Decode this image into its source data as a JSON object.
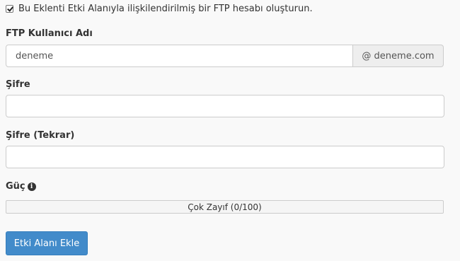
{
  "checkbox": {
    "checked": true,
    "label": "Bu Eklenti Etki Alanıyla ilişkilendirilmiş bir FTP hesabı oluşturun."
  },
  "ftp_username": {
    "label": "FTP Kullanıcı Adı",
    "value": "deneme",
    "domain_suffix": "@ deneme.com"
  },
  "password": {
    "label": "Şifre",
    "value": ""
  },
  "password_confirm": {
    "label": "Şifre (Tekrar)",
    "value": ""
  },
  "strength": {
    "label": "Güç",
    "info_icon": "info-circle",
    "meter_text": "Çok Zayıf (0/100)",
    "score": 0
  },
  "submit_button": {
    "label": "Etki Alanı Ekle",
    "color": "#428bca"
  }
}
